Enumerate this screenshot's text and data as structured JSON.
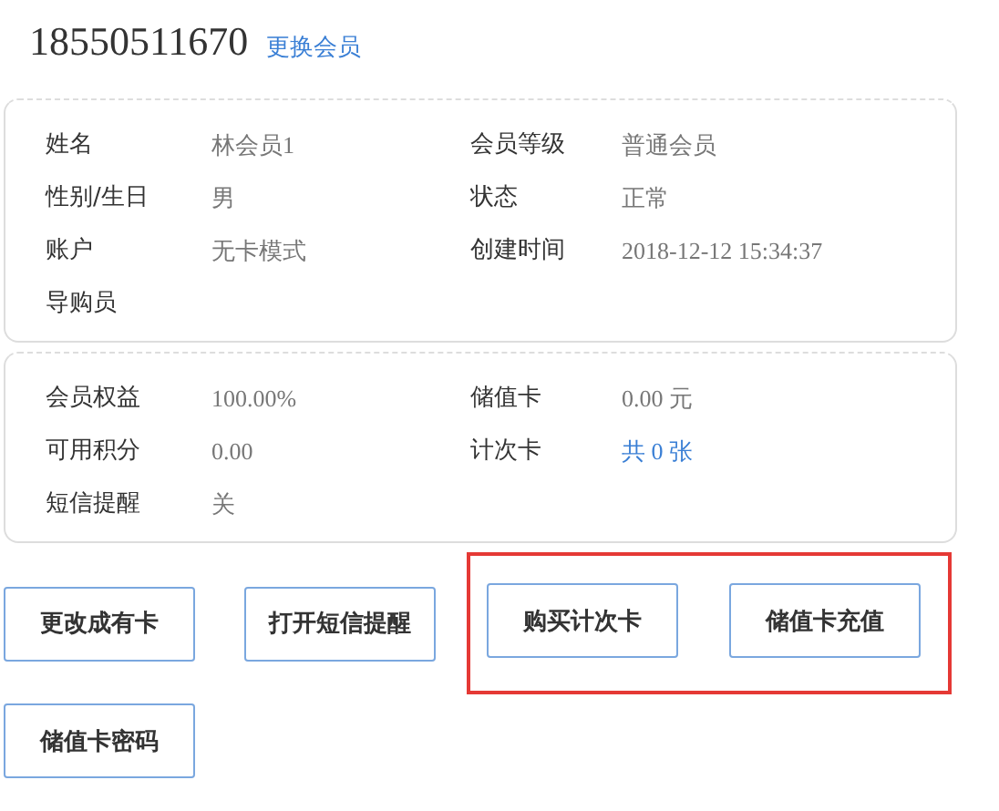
{
  "member": {
    "phone": "18550511670",
    "change_link": "更换会员"
  },
  "cards": [
    {
      "fields": [
        {
          "label": "姓名",
          "value": "林会员1",
          "link": false
        },
        {
          "label": "会员等级",
          "value": "普通会员",
          "link": false
        },
        {
          "label": "性别/生日",
          "value": "男",
          "link": false
        },
        {
          "label": "状态",
          "value": "正常",
          "link": false
        },
        {
          "label": "账户",
          "value": "无卡模式",
          "link": false
        },
        {
          "label": "创建时间",
          "value": "2018-12-12 15:34:37",
          "link": false
        },
        {
          "label": "导购员"
        }
      ]
    },
    {
      "fields": [
        {
          "label": "会员权益",
          "value": "100.00%",
          "link": false
        },
        {
          "label": "储值卡",
          "value": "0.00 元",
          "link": false
        },
        {
          "label": "可用积分",
          "value": "0.00",
          "link": false
        },
        {
          "label": "计次卡",
          "value": "共 0 张",
          "link": true
        },
        {
          "label": "短信提醒",
          "value": "关",
          "link": false
        }
      ]
    }
  ],
  "buttons": [
    {
      "kind": "button",
      "label": "更改成有卡"
    },
    {
      "kind": "button",
      "label": "打开短信提醒"
    },
    {
      "kind": "highlight",
      "buttons": [
        {
          "label": "购买计次卡"
        },
        {
          "label": "储值卡充值"
        }
      ]
    },
    {
      "kind": "button",
      "label": "储值卡密码"
    }
  ]
}
